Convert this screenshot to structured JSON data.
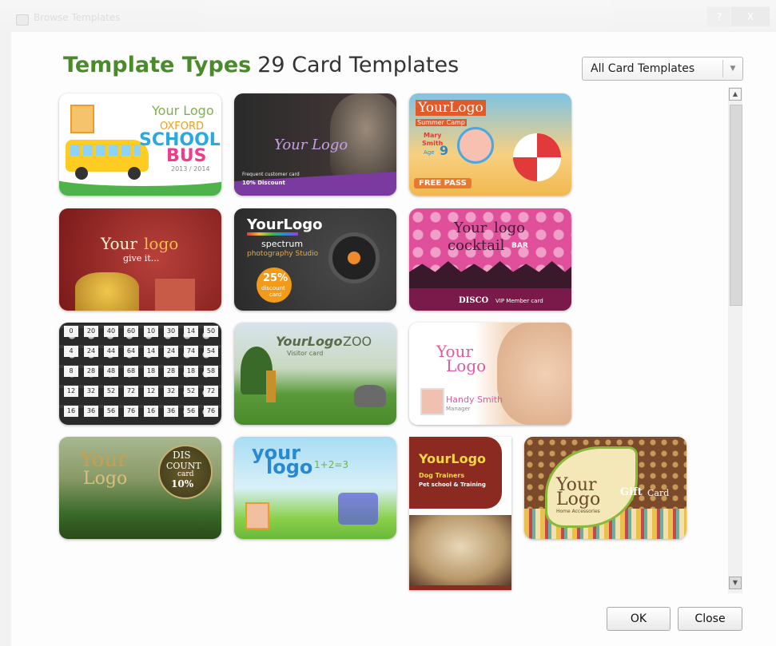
{
  "window": {
    "title": "Browse Templates",
    "help_label": "?",
    "close_label": "X"
  },
  "header": {
    "title": "Template Types",
    "count_label": "29 Card Templates"
  },
  "filter": {
    "selected": "All Card Templates",
    "arrow": "▼"
  },
  "scrollbar": {
    "up": "▲",
    "down": "▼"
  },
  "buttons": {
    "ok": "OK",
    "close": "Close"
  },
  "templates": [
    {
      "name": "school-bus",
      "lines": [
        "Your Logo",
        "OXFORD",
        "SCHOOL",
        "BUS",
        "2013 / 2014"
      ]
    },
    {
      "name": "spa",
      "lines": [
        "Your Logo",
        "Frequent customer card",
        "10% Discount"
      ]
    },
    {
      "name": "summer-camp",
      "lines": [
        "YourLogo",
        "Summer Camp",
        "Mary",
        "Smith",
        "Age",
        "9",
        "FREE PASS"
      ]
    },
    {
      "name": "gift",
      "lines": [
        "Your",
        "logo",
        "give it..."
      ]
    },
    {
      "name": "photography",
      "lines": [
        "YourLogo",
        "spectrum",
        "photography Studio",
        "25%",
        "discount",
        "card"
      ]
    },
    {
      "name": "cocktail-bar",
      "lines": [
        "Your",
        "logo",
        "cocktail",
        "BAR",
        "DISCO",
        "VIP Member card"
      ]
    },
    {
      "name": "number-grid",
      "lines": []
    },
    {
      "name": "zoo",
      "lines": [
        "YourLogo",
        "ZOO",
        "Visitor card"
      ]
    },
    {
      "name": "beauty",
      "lines": [
        "Your",
        "Logo",
        "Handy Smith",
        "Manager"
      ]
    },
    {
      "name": "restaurant",
      "lines": [
        "Your",
        "Logo",
        "DIS",
        "COUNT",
        "card",
        "10%"
      ]
    },
    {
      "name": "kids",
      "lines": [
        "your",
        "logo",
        "1+2=3"
      ]
    },
    {
      "name": "dog-trainer",
      "lines": [
        "YourLogo",
        "Dog Trainers",
        "Pet school & Training"
      ]
    },
    {
      "name": "gift-card",
      "lines": [
        "Your",
        "Logo",
        "Gift",
        "Card",
        "Home Accessories"
      ]
    }
  ]
}
